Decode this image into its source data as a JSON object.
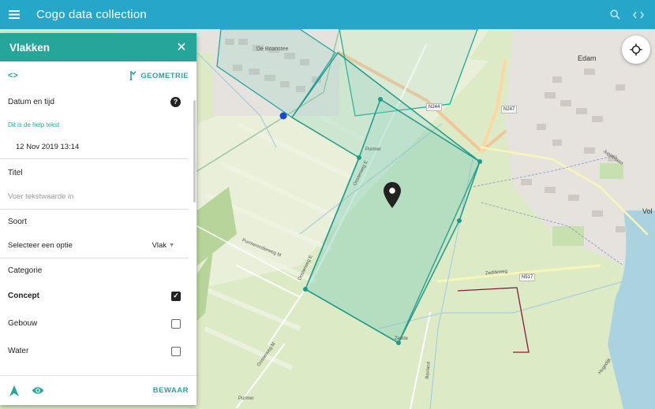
{
  "app": {
    "title": "Cogo data collection"
  },
  "colors": {
    "appbar": "#26a6c9",
    "panel_header": "#26a69a",
    "accent": "#26a69a",
    "polygon": "#1f9a8a",
    "parcel_outline": "#8b1a3a"
  },
  "topbar": {
    "menu_icon": "hamburger-menu-icon",
    "search_icon": "search-icon",
    "code_icon": "code-icon"
  },
  "panel": {
    "title": "Vlakken",
    "close_icon": "close-icon",
    "code_label": "<>",
    "geometry_label": "GEOMETRIE",
    "fields": {
      "datetime": {
        "label": "Datum en tijd",
        "help_text": "Dit is de help tekst",
        "value": "12 Nov 2019 13:14"
      },
      "title": {
        "label": "Titel",
        "placeholder": "Voer tekstwaarde in"
      },
      "kind": {
        "label": "Soort",
        "prompt": "Selecteer een optie",
        "selected": "Vlak"
      },
      "category": {
        "label": "Categorie",
        "options": [
          {
            "label": "Concept",
            "checked": true
          },
          {
            "label": "Gebouw",
            "checked": false
          },
          {
            "label": "Water",
            "checked": false
          }
        ]
      }
    },
    "footer": {
      "navigate_icon": "navigation-arrow-icon",
      "view_icon": "eye-icon",
      "save_label": "BEWAAR"
    }
  },
  "map": {
    "labels": {
      "boanstee": "De Boanstee",
      "edam": "Edam",
      "volendam": "Vol",
      "purmer_1": "Purmer",
      "purmer_2": "Purmer",
      "zedde": "Zedde",
      "oosterweg_1": "Oosterweg E",
      "oosterweg_2": "Oosterweg E",
      "oosterweg_3": "Oosterweg M",
      "purmerenderweg": "Purmerenderweg M",
      "zeddeweg": "Zeddeweg",
      "baxland": "Baxland",
      "hoogedijk": "Hogedijk",
      "jupiterlaan": "Jupiterlaan"
    },
    "road_badges": {
      "n244": "N244",
      "n247": "N247",
      "n517": "N517"
    },
    "locate_icon": "crosshair-locate-icon"
  }
}
